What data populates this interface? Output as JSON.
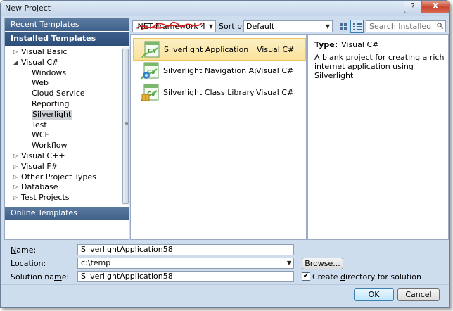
{
  "window": {
    "title": "New Project",
    "help_glyph": "?",
    "close_glyph": "X"
  },
  "left": {
    "recent": "Recent Templates",
    "installed": "Installed Templates",
    "online": "Online Templates",
    "tree": [
      {
        "label": "Visual Basic",
        "expander": "▷",
        "level": 0
      },
      {
        "label": "Visual C#",
        "expander": "◢",
        "level": 0
      },
      {
        "label": "Windows",
        "level": 1
      },
      {
        "label": "Web",
        "level": 1
      },
      {
        "label": "Cloud Service",
        "level": 1
      },
      {
        "label": "Reporting",
        "level": 1
      },
      {
        "label": "Silverlight",
        "level": 1,
        "selected": true
      },
      {
        "label": "Test",
        "level": 1
      },
      {
        "label": "WCF",
        "level": 1
      },
      {
        "label": "Workflow",
        "level": 1
      },
      {
        "label": "Visual C++",
        "expander": "▷",
        "level": 0
      },
      {
        "label": "Visual F#",
        "expander": "▷",
        "level": 0
      },
      {
        "label": "Other Project Types",
        "expander": "▷",
        "level": 0
      },
      {
        "label": "Database",
        "expander": "▷",
        "level": 0
      },
      {
        "label": "Test Projects",
        "expander": "▷",
        "level": 0
      }
    ]
  },
  "toolbar": {
    "framework": ".NET Framework 4",
    "sort_label": "Sort by:",
    "sort_value": "Default",
    "search_placeholder": "Search Installed Tem"
  },
  "templates": [
    {
      "name": "Silverlight Application",
      "lang": "Visual C#",
      "selected": true
    },
    {
      "name": "Silverlight Navigation Applicati...",
      "lang": "Visual C#"
    },
    {
      "name": "Silverlight Class Library",
      "lang": "Visual C#"
    }
  ],
  "details": {
    "type_label": "Type:",
    "type_value": "Visual C#",
    "description": "A blank project for creating a rich internet application using Silverlight"
  },
  "form": {
    "name_label_pre": "",
    "name_label_key": "N",
    "name_label_post": "ame:",
    "name_value": "SilverlightApplication58",
    "location_label_key": "L",
    "location_label_post": "ocation:",
    "location_value": "c:\\temp",
    "solution_label_pre": "Solution na",
    "solution_label_key": "m",
    "solution_label_post": "e:",
    "solution_value": "SilverlightApplication58",
    "browse_label_key": "B",
    "browse_label_post": "rowse...",
    "checkbox_checked": "✔",
    "checkbox_label_pre": "Create ",
    "checkbox_label_key": "d",
    "checkbox_label_post": "irectory for solution"
  },
  "buttons": {
    "ok": "OK",
    "cancel": "Cancel"
  }
}
